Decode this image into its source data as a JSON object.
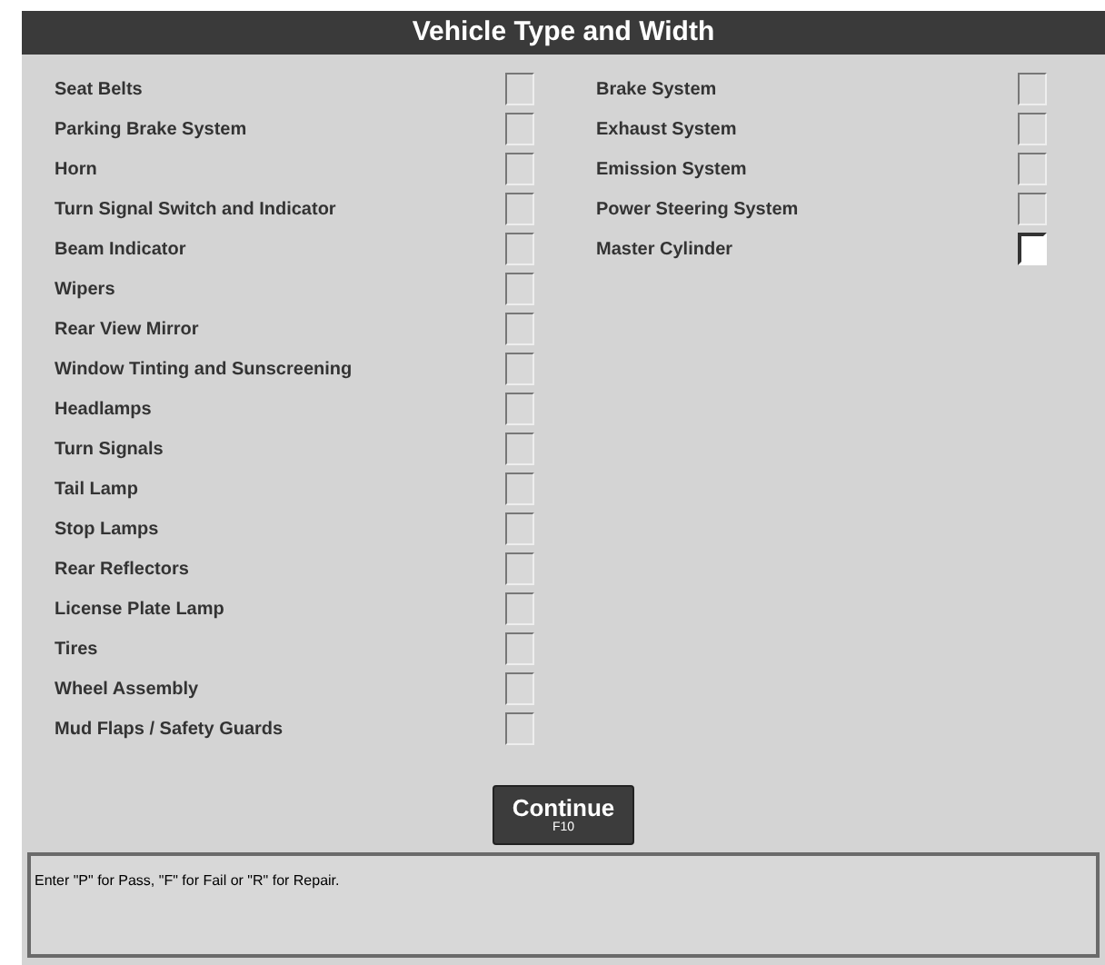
{
  "header": {
    "title": "Vehicle Type and Width"
  },
  "columns": [
    {
      "items": [
        {
          "label": "Seat Belts",
          "focused": false
        },
        {
          "label": "Parking Brake System",
          "focused": false
        },
        {
          "label": "Horn",
          "focused": false
        },
        {
          "label": "Turn Signal Switch and Indicator",
          "focused": false
        },
        {
          "label": "Beam Indicator",
          "focused": false
        },
        {
          "label": "Wipers",
          "focused": false
        },
        {
          "label": "Rear View Mirror",
          "focused": false
        },
        {
          "label": "Window Tinting and Sunscreening",
          "focused": false
        },
        {
          "label": "Headlamps",
          "focused": false
        },
        {
          "label": "Turn Signals",
          "focused": false
        },
        {
          "label": "Tail Lamp",
          "focused": false
        },
        {
          "label": "Stop Lamps",
          "focused": false
        },
        {
          "label": "Rear Reflectors",
          "focused": false
        },
        {
          "label": "License Plate Lamp",
          "focused": false
        },
        {
          "label": "Tires",
          "focused": false
        },
        {
          "label": "Wheel Assembly",
          "focused": false
        },
        {
          "label": "Mud Flaps / Safety Guards",
          "focused": false
        }
      ]
    },
    {
      "items": [
        {
          "label": "Brake System",
          "focused": false
        },
        {
          "label": "Exhaust System",
          "focused": false
        },
        {
          "label": "Emission System",
          "focused": false
        },
        {
          "label": "Power Steering System",
          "focused": false
        },
        {
          "label": "Master Cylinder",
          "focused": true
        }
      ]
    }
  ],
  "continue_button": {
    "label": "Continue",
    "hotkey": "F10"
  },
  "message": "Enter \"P\" for Pass, \"F\" for Fail or \"R\" for Repair."
}
